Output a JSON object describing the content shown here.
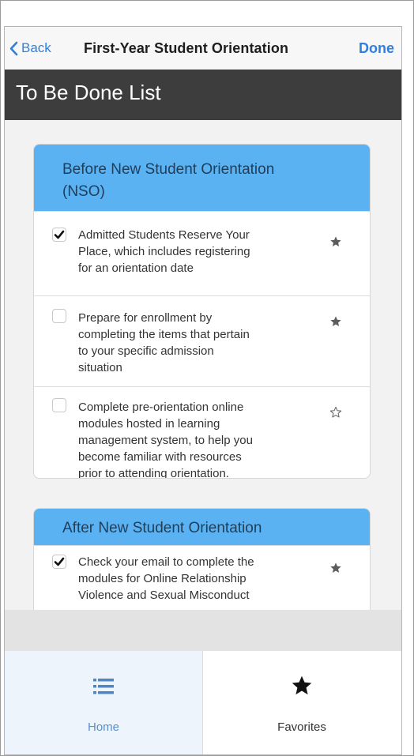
{
  "nav": {
    "back_label": "Back",
    "title": "First-Year Student Orientation",
    "done_label": "Done"
  },
  "header": {
    "title": "To Be Done List"
  },
  "sections": [
    {
      "title_line1": "Before New Student Orientation",
      "title_line2": "(NSO)",
      "items": [
        {
          "checked": true,
          "favorite": true,
          "lines": [
            "Admitted Students Reserve Your",
            "Place, which includes registering",
            "for an orientation date"
          ]
        },
        {
          "checked": false,
          "favorite": true,
          "lines": [
            "Prepare for enrollment by",
            "completing the items that pertain",
            "to your specific admission",
            "situation"
          ]
        },
        {
          "checked": false,
          "favorite": false,
          "lines": [
            "Complete pre-orientation online",
            "modules hosted in learning",
            "management system, to help you",
            "become familiar with resources",
            "prior to attending orientation."
          ]
        }
      ]
    },
    {
      "title_line1": "After New Student Orientation",
      "items": [
        {
          "checked": true,
          "favorite": true,
          "lines": [
            "Check your email to complete the",
            "modules for Online Relationship",
            "Violence and Sexual Misconduct"
          ]
        }
      ]
    }
  ],
  "tabs": {
    "home_label": "Home",
    "favorites_label": "Favorites"
  },
  "colors": {
    "accent": "#2f7fe3",
    "section_header": "#5ab2f2",
    "title_bar": "#3d3d3d",
    "home_tab_text": "#5a8fc9"
  },
  "icons": {
    "back": "chevron-left-icon",
    "checkbox_checked": "checkmark-icon",
    "favorite": "star-filled-icon",
    "not_favorite": "star-outline-icon",
    "home": "list-icon",
    "favorites": "star-filled-icon"
  }
}
